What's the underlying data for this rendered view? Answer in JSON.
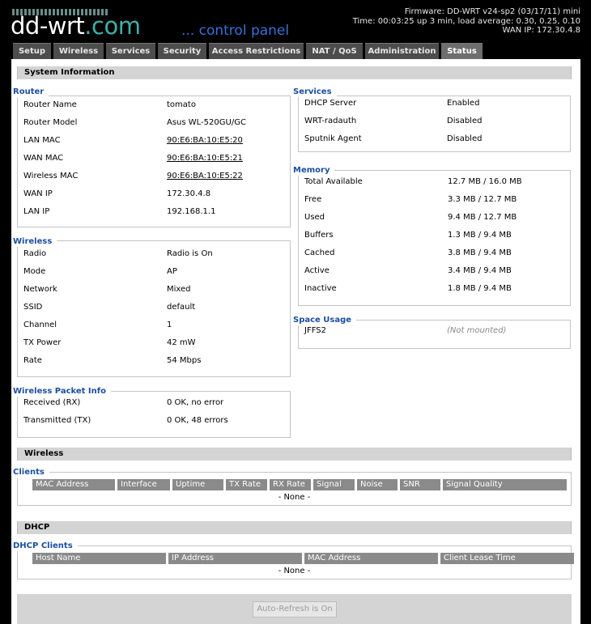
{
  "header": {
    "logo_main": "dd-wrt",
    "logo_com": ".com",
    "logo_sub": "... control panel",
    "firmware": "Firmware: DD-WRT v24-sp2 (03/17/11) mini",
    "time": "Time: 00:03:25 up 3 min, load average: 0.30, 0.25, 0.10",
    "wan_ip": "WAN IP: 172.30.4.8"
  },
  "tabs": [
    "Setup",
    "Wireless",
    "Services",
    "Security",
    "Access Restrictions",
    "NAT / QoS",
    "Administration",
    "Status"
  ],
  "active_tab": "Status",
  "system_info": {
    "title": "System Information",
    "router": {
      "legend": "Router",
      "rows": [
        {
          "label": "Router Name",
          "value": "tomato"
        },
        {
          "label": "Router Model",
          "value": "Asus WL-520GU/GC"
        },
        {
          "label": "LAN MAC",
          "value": "90:E6:BA:10:E5:20"
        },
        {
          "label": "WAN MAC",
          "value": "90:E6:BA:10:E5:21"
        },
        {
          "label": "Wireless MAC",
          "value": "90:E6:BA:10:E5:22"
        },
        {
          "label": "WAN IP",
          "value": "172.30.4.8"
        },
        {
          "label": "LAN IP",
          "value": "192.168.1.1"
        }
      ]
    },
    "wireless": {
      "legend": "Wireless",
      "rows": [
        {
          "label": "Radio",
          "value": "Radio is On"
        },
        {
          "label": "Mode",
          "value": "AP"
        },
        {
          "label": "Network",
          "value": "Mixed"
        },
        {
          "label": "SSID",
          "value": "default"
        },
        {
          "label": "Channel",
          "value": "1"
        },
        {
          "label": "TX Power",
          "value": "42 mW"
        },
        {
          "label": "Rate",
          "value": "54 Mbps"
        }
      ]
    },
    "packet_info": {
      "legend": "Wireless Packet Info",
      "rows": [
        {
          "label": "Received (RX)",
          "value": "0 OK, no error"
        },
        {
          "label": "Transmitted (TX)",
          "value": "0 OK, 48 errors"
        }
      ]
    },
    "services": {
      "legend": "Services",
      "rows": [
        {
          "label": "DHCP Server",
          "value": "Enabled"
        },
        {
          "label": "WRT-radauth",
          "value": "Disabled"
        },
        {
          "label": "Sputnik Agent",
          "value": "Disabled"
        }
      ]
    },
    "memory": {
      "legend": "Memory",
      "rows": [
        {
          "label": "Total Available",
          "value": "12.7 MB / 16.0 MB"
        },
        {
          "label": "Free",
          "value": "3.3 MB / 12.7 MB"
        },
        {
          "label": "Used",
          "value": "9.4 MB / 12.7 MB"
        },
        {
          "label": "Buffers",
          "value": "1.3 MB / 9.4 MB"
        },
        {
          "label": "Cached",
          "value": "3.8 MB / 9.4 MB"
        },
        {
          "label": "Active",
          "value": "3.4 MB / 9.4 MB"
        },
        {
          "label": "Inactive",
          "value": "1.8 MB / 9.4 MB"
        }
      ]
    },
    "space_usage": {
      "legend": "Space Usage",
      "rows": [
        {
          "label": "JFFS2",
          "value": "(Not mounted)"
        }
      ]
    }
  },
  "wireless_section": {
    "title": "Wireless",
    "clients_legend": "Clients",
    "columns": [
      "MAC Address",
      "Interface",
      "Uptime",
      "TX Rate",
      "RX Rate",
      "Signal",
      "Noise",
      "SNR",
      "Signal Quality"
    ],
    "empty_text": "- None -"
  },
  "dhcp_section": {
    "title": "DHCP",
    "clients_legend": "DHCP Clients",
    "columns": [
      "Host Name",
      "IP Address",
      "MAC Address",
      "Client Lease Time"
    ],
    "empty_text": "- None -"
  },
  "footer": {
    "refresh_label": "Auto-Refresh is On"
  }
}
